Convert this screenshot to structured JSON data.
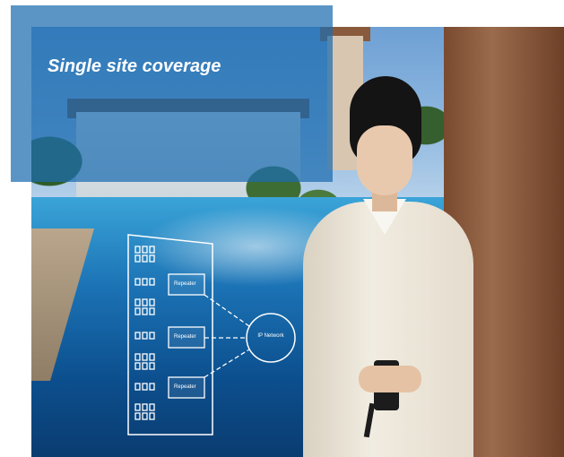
{
  "banner": {
    "title": "Single site coverage",
    "color": "#1c6cb0"
  },
  "diagram": {
    "repeaters": [
      {
        "label": "Repeater"
      },
      {
        "label": "Repeater"
      },
      {
        "label": "Repeater"
      }
    ],
    "network_label": "IP Network",
    "line_color": "#ffffff"
  }
}
